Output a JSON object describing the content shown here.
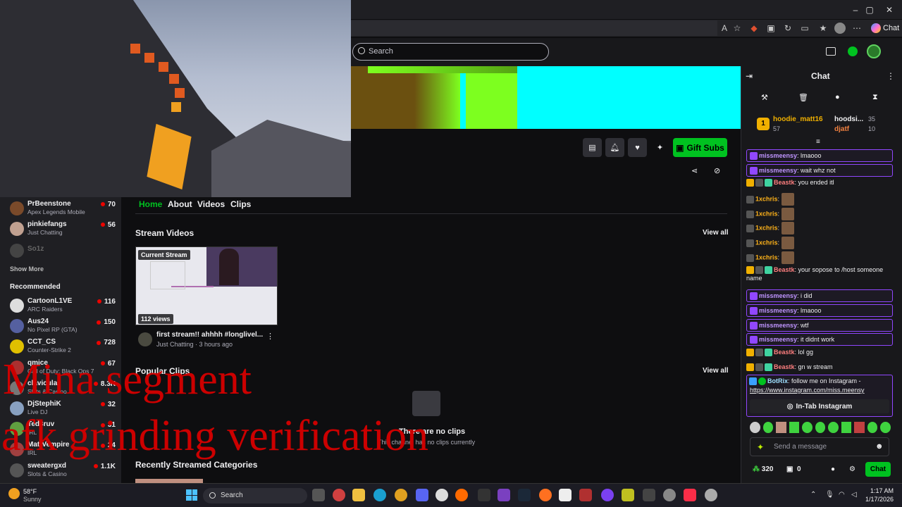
{
  "browser": {
    "window_controls": [
      "–",
      "▢",
      "✕"
    ],
    "chat_button": "Chat"
  },
  "twitch": {
    "search_placeholder": "Search",
    "tabs": [
      "Home",
      "About",
      "Videos",
      "Clips"
    ],
    "gift_button": "Gift Subs",
    "sections": {
      "stream_videos": "Stream Videos",
      "popular_clips": "Popular Clips",
      "recent_categories": "Recently Streamed Categories",
      "view_all": "View all"
    },
    "video": {
      "badge": "Current Stream",
      "views": "112 views",
      "title": "first stream!! ahhhh #longlivel...",
      "category": "Just Chatting",
      "age": "3 hours ago"
    },
    "no_clips": {
      "title": "There are no clips",
      "sub": "This channel has no clips currently"
    }
  },
  "sidebar": {
    "followed": [
      {
        "name": "PrBeenstone",
        "game": "Apex Legends Mobile",
        "viewers": "70",
        "color": "#7a4a2a"
      },
      {
        "name": "pinkiefangs",
        "game": "Just Chatting",
        "viewers": "56",
        "color": "#c0a090"
      }
    ],
    "offline": "So1z",
    "show_more": "Show More",
    "recommended_title": "Recommended",
    "recommended": [
      {
        "name": "CartoonL1VE",
        "game": "ARC Raiders",
        "viewers": "116",
        "color": "#ddd"
      },
      {
        "name": "Aus24",
        "game": "No Pixel RP (GTA)",
        "viewers": "150",
        "color": "#5560a0"
      },
      {
        "name": "CCT_CS",
        "game": "Counter-Strike 2",
        "viewers": "728",
        "color": "#e0c000"
      },
      {
        "name": "qmice",
        "game": "Call of Duty: Black Ops 7",
        "viewers": "67",
        "color": "#aa3030"
      },
      {
        "name": "clavicular",
        "game": "Slots & Casino",
        "viewers": "8.3K",
        "color": "#777"
      },
      {
        "name": "DjStephiK",
        "game": "Live DJ",
        "viewers": "32",
        "color": "#88a0c0"
      },
      {
        "name": "Ted3ruv",
        "game": "IRL",
        "viewers": "31",
        "color": "#60a040"
      },
      {
        "name": "MattVempire",
        "game": "IRL",
        "viewers": "24",
        "color": "#a04040"
      },
      {
        "name": "sweatergxd",
        "game": "Slots & Casino",
        "viewers": "1.1K",
        "color": "#555"
      }
    ]
  },
  "overlay": {
    "line1": "Mina segment",
    "line2": "afk grinding verification"
  },
  "chat": {
    "title": "Chat",
    "leaderboard": [
      {
        "rank": "1",
        "name": "hoodie_matt16",
        "count": "57"
      },
      {
        "name": "hoodsi...",
        "count": "35"
      },
      {
        "name": "djatf",
        "count": "10"
      }
    ],
    "messages": [
      {
        "user": "missmeensy",
        "text": ": lmaooo",
        "color": "#bf94ff",
        "hl": true
      },
      {
        "user": "missmeensy",
        "text": ": wait whz not",
        "color": "#bf94ff",
        "hl": true
      },
      {
        "user": "Beastk",
        "text": ": you ended itl",
        "color": "#ff7f7f",
        "hl": false
      },
      {
        "user": "1xchris",
        "text": ":",
        "color": "#ffb31a",
        "hl": false,
        "emote": true
      },
      {
        "user": "1xchris",
        "text": ":",
        "color": "#ffb31a",
        "hl": false,
        "emote": true
      },
      {
        "user": "1xchris",
        "text": ":",
        "color": "#ffb31a",
        "hl": false,
        "emote": true
      },
      {
        "user": "1xchris",
        "text": ":",
        "color": "#ffb31a",
        "hl": false,
        "emote": true
      },
      {
        "user": "1xchris",
        "text": ":",
        "color": "#ffb31a",
        "hl": false,
        "emote": true
      },
      {
        "user": "Beastk",
        "text": ": your sopose to /host someone name",
        "color": "#ff7f7f",
        "hl": false
      },
      {
        "user": "missmeensy",
        "text": ": i did",
        "color": "#bf94ff",
        "hl": true
      },
      {
        "user": "missmeensy",
        "text": ": lmaooo",
        "color": "#bf94ff",
        "hl": true
      },
      {
        "user": "missmeensy",
        "text": ": wtf",
        "color": "#bf94ff",
        "hl": true
      },
      {
        "user": "missmeensy",
        "text": ": it didnt work",
        "color": "#bf94ff",
        "hl": true
      },
      {
        "user": "Beastk",
        "text": ": lol gg",
        "color": "#ff7f7f",
        "hl": false
      },
      {
        "user": "Beastk",
        "text": ": gn w stream",
        "color": "#ff7f7f",
        "hl": false
      }
    ],
    "bot_user": "BotRix",
    "bot_text": ": follow me on Instagram -",
    "bot_link": "https://www.instagram.com/miss.meensy",
    "bot_button": "In-Tab Instagram",
    "input_placeholder": "Send a message",
    "points": "320",
    "gifts": "0",
    "chat_button": "Chat"
  },
  "taskbar": {
    "weather_temp": "58°F",
    "weather_desc": "Sunny",
    "search": "Search",
    "time": "1:17 AM",
    "date": "1/17/2026"
  },
  "colors": {
    "twitch_green": "#00c220",
    "twitch_purple": "#9147ff",
    "live_red": "#eb0400"
  }
}
